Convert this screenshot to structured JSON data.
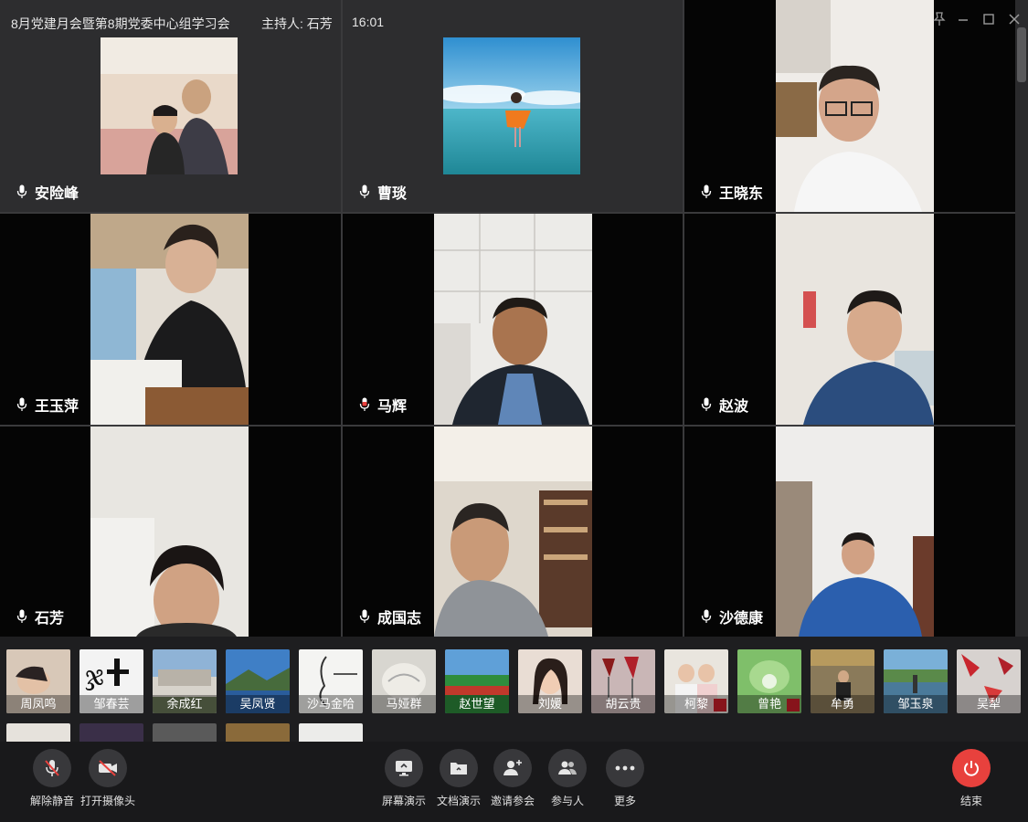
{
  "meeting": {
    "title": "8月党建月会暨第8期党委中心组学习会",
    "host": "主持人: 石芳",
    "time": "16:01"
  },
  "window_controls": [
    "pin-icon",
    "minimize-icon",
    "maximize-icon",
    "close-icon"
  ],
  "participants": [
    {
      "name": "安险峰"
    },
    {
      "name": "曹琰"
    },
    {
      "name": "王晓东"
    },
    {
      "name": "王玉萍"
    },
    {
      "name": "马辉"
    },
    {
      "name": "赵波"
    },
    {
      "name": "石芳"
    },
    {
      "name": "成国志"
    },
    {
      "name": "沙德康"
    }
  ],
  "thumbnails": [
    {
      "name": "周凤鸣"
    },
    {
      "name": "邹春芸"
    },
    {
      "name": "余成红"
    },
    {
      "name": "吴凤贤"
    },
    {
      "name": "沙马金哈"
    },
    {
      "name": "马娅群"
    },
    {
      "name": "赵世望"
    },
    {
      "name": "刘媛"
    },
    {
      "name": "胡云贵"
    },
    {
      "name": "柯黎"
    },
    {
      "name": "曾艳"
    },
    {
      "name": "牟勇"
    },
    {
      "name": "邹玉泉"
    },
    {
      "name": "吴犁"
    }
  ],
  "toolbar": {
    "unmute": "解除静音",
    "camera": "打开摄像头",
    "screen_share": "屏幕演示",
    "doc_share": "文档演示",
    "invite": "邀请参会",
    "participants": "参与人",
    "more": "更多",
    "end": "结束"
  },
  "colors": {
    "end_button": "#e8413d",
    "background": "#1b1b1d",
    "audio_tile": "#2d2d2f"
  }
}
